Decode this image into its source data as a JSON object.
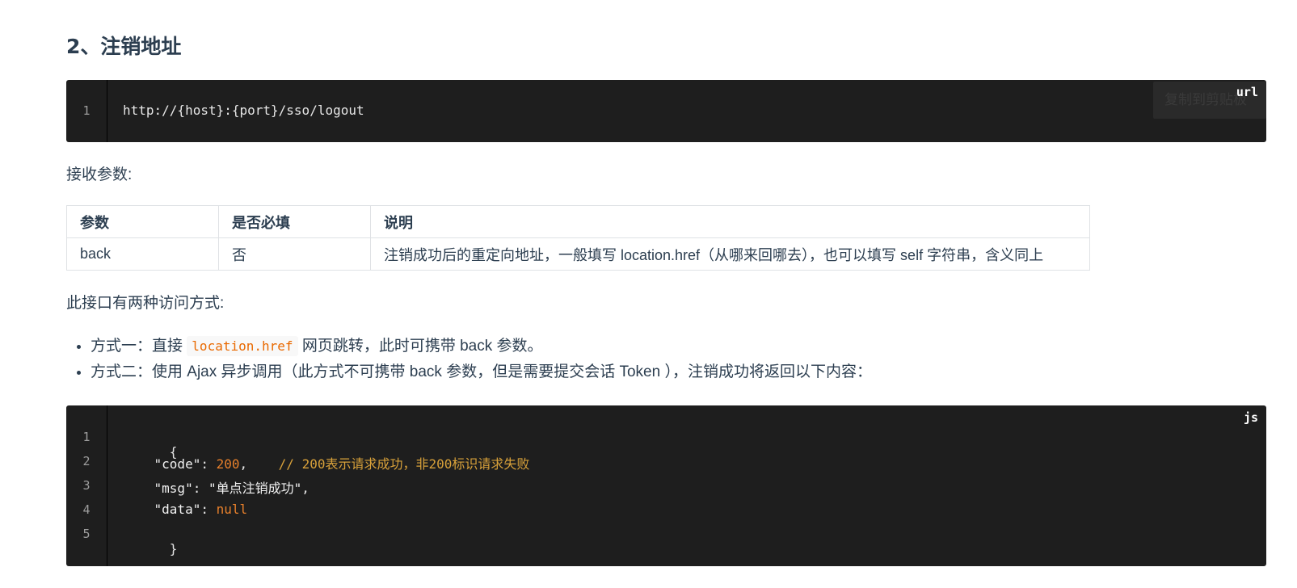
{
  "section": {
    "heading": "2、注销地址"
  },
  "url_block": {
    "lang": "url",
    "copy_label": "复制到剪贴板",
    "line_numbers": [
      "1"
    ],
    "url": "http://{host}:{port}/sso/logout"
  },
  "params_intro": "接收参数:",
  "params_table": {
    "headers": [
      "参数",
      "是否必填",
      "说明"
    ],
    "rows": [
      [
        "back",
        "否",
        "注销成功后的重定向地址，一般填写 location.href（从哪来回哪去），也可以填写 self 字符串，含义同上"
      ]
    ]
  },
  "access_intro": "此接口有两种访问方式:",
  "ways": {
    "way1_prefix": "方式一：直接",
    "way1_code": "location.href",
    "way1_suffix": "网页跳转，此时可携带 back 参数。",
    "way2": "方式二：使用 Ajax 异步调用（此方式不可携带 back 参数，但是需要提交会话 Token ），注销成功将返回以下内容："
  },
  "js_block": {
    "lang": "js",
    "line_numbers": [
      "1",
      "2",
      "3",
      "4",
      "5"
    ],
    "open_brace": "{",
    "code_key": "\"code\"",
    "code_value": "200",
    "code_comment": "// 200表示请求成功，非200标识请求失败",
    "msg_key": "\"msg\"",
    "msg_value": "\"单点注销成功\"",
    "data_key": "\"data\"",
    "data_value": "null",
    "close_brace": "}"
  }
}
